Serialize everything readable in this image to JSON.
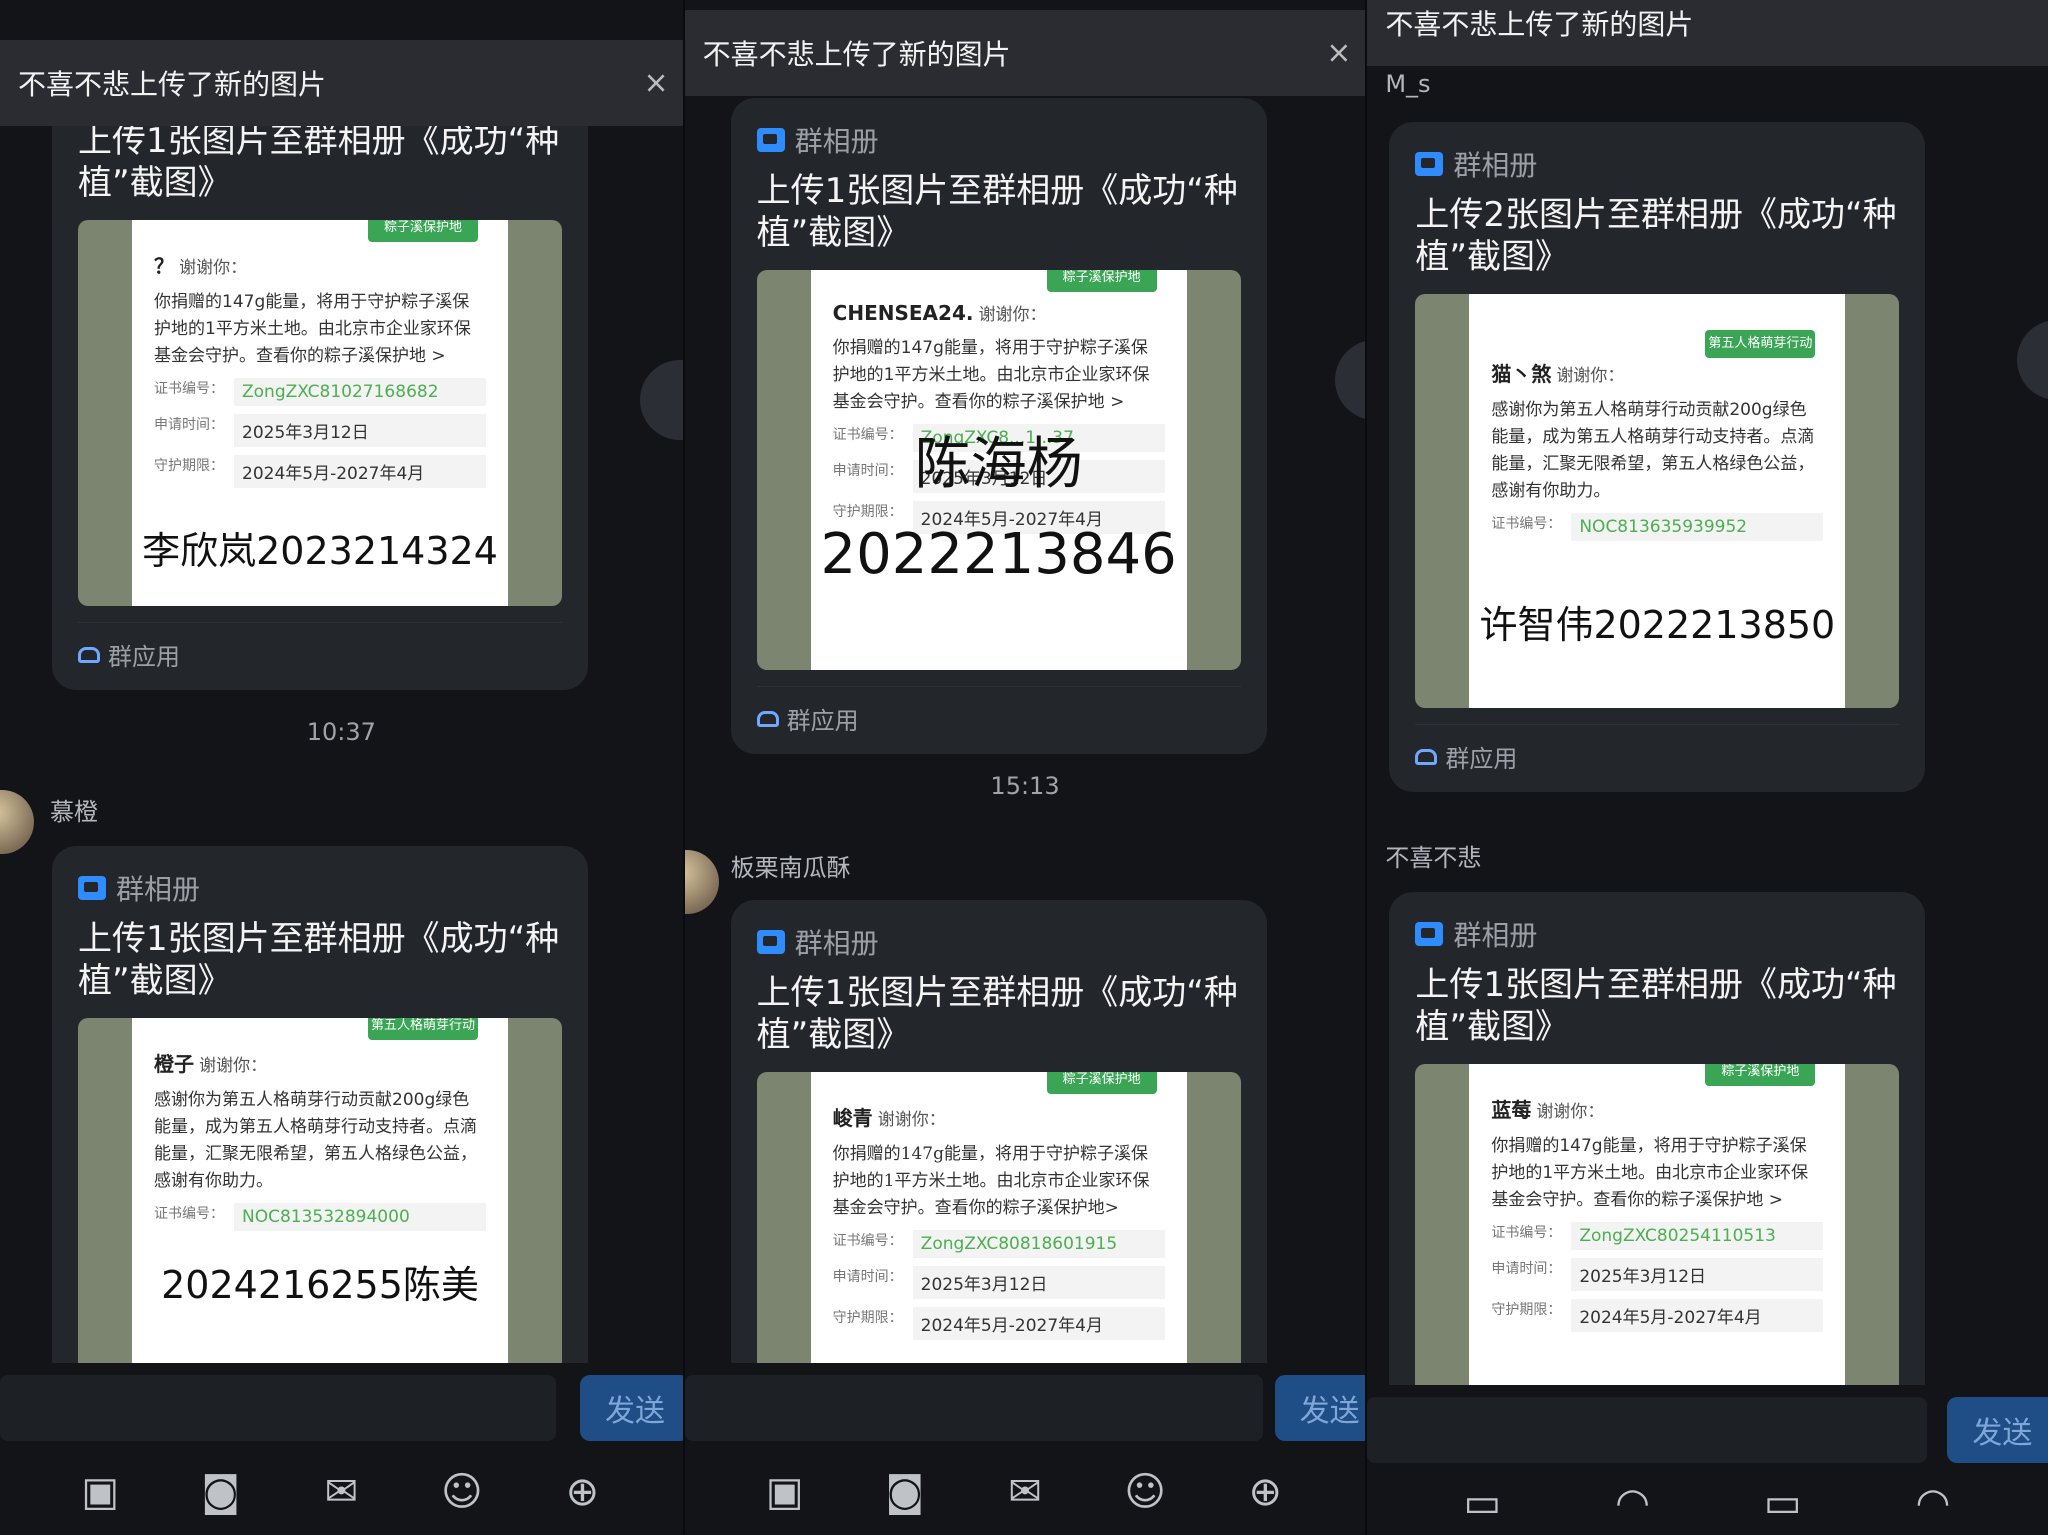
{
  "panels": [
    {
      "notification": {
        "text": "不喜不悲上传了新的图片",
        "close": "×"
      },
      "cards": [
        {
          "head": "群相册",
          "title": "上传1张图片至群相册《成功“种植”截图》",
          "cert": {
            "ribbon": "粽子溪保护地",
            "name": "？",
            "thanks": "谢谢你：",
            "body": "你捐赠的147g能量，将用于守护粽子溪保护地的1平方米土地。由北京市企业家环保基金会守护。查看你的粽子溪保护地 >",
            "rows": [
              {
                "k": "证书编号：",
                "v": "ZongZXC81027168682"
              },
              {
                "k": "申请时间：",
                "v": "2025年3月12日"
              },
              {
                "k": "守护期限：",
                "v": "2024年5月-2027年4月"
              }
            ],
            "overlay": "李欣岚2023214324"
          },
          "foot": "群应用"
        },
        {
          "head": "群相册",
          "title": "上传1张图片至群相册《成功“种植”截图》",
          "cert": {
            "ribbon": "第五人格萌芽行动",
            "name": "橙子",
            "thanks": "谢谢你：",
            "body": "感谢你为第五人格萌芽行动贡献200g绿色能量，成为第五人格萌芽行动支持者。点滴能量，汇聚无限希望，第五人格绿色公益，感谢有你助力。",
            "rows": [
              {
                "k": "证书编号：",
                "v": "NOC813532894000"
              }
            ],
            "overlay": "2024216255陈美"
          },
          "foot": ""
        }
      ],
      "timestamp": "10:37",
      "sender": "慕橙",
      "send": "发送"
    },
    {
      "notification": {
        "text": "不喜不悲上传了新的图片",
        "close": "×"
      },
      "cards": [
        {
          "head": "群相册",
          "title": "上传1张图片至群相册《成功“种植”截图》",
          "cert": {
            "ribbon": "粽子溪保护地",
            "name": "CHENSEA24.",
            "thanks": "谢谢你：",
            "body": "你捐赠的147g能量，将用于守护粽子溪保护地的1平方米土地。由北京市企业家环保基金会守护。查看你的粽子溪保护地 >",
            "rows": [
              {
                "k": "证书编号：",
                "v": "ZongZXC8...1...37"
              },
              {
                "k": "申请时间：",
                "v": "2025年3月12日"
              },
              {
                "k": "守护期限：",
                "v": "2024年5月-2027年4月"
              }
            ],
            "overlay": "陈海杨\n2022213846"
          },
          "foot": "群应用"
        },
        {
          "head": "群相册",
          "title": "上传1张图片至群相册《成功“种植”截图》",
          "cert": {
            "ribbon": "粽子溪保护地",
            "name": "峻青",
            "thanks": "谢谢你：",
            "body": "你捐赠的147g能量，将用于守护粽子溪保护地的1平方米土地。由北京市企业家环保基金会守护。查看你的粽子溪保护地>",
            "rows": [
              {
                "k": "证书编号：",
                "v": "ZongZXC80818601915"
              },
              {
                "k": "申请时间：",
                "v": "2025年3月12日"
              },
              {
                "k": "守护期限：",
                "v": "2024年5月-2027年4月"
              }
            ],
            "overlay": ""
          },
          "foot": ""
        }
      ],
      "timestamp": "15:13",
      "sender": "板栗南瓜酥",
      "send": "发送"
    },
    {
      "notification": {
        "text": "不喜不悲上传了新的图片",
        "close": ""
      },
      "sender_top": "M_s",
      "cards": [
        {
          "head": "群相册",
          "title": "上传2张图片至群相册《成功“种植”截图》",
          "cert": {
            "ribbon": "第五人格萌芽行动",
            "name": "猫丶煞",
            "thanks": "谢谢你：",
            "body": "感谢你为第五人格萌芽行动贡献200g绿色能量，成为第五人格萌芽行动支持者。点滴能量，汇聚无限希望，第五人格绿色公益，感谢有你助力。",
            "rows": [
              {
                "k": "证书编号：",
                "v": "NOC813635939952"
              }
            ],
            "overlay": "许智伟2022213850"
          },
          "foot": "群应用"
        },
        {
          "head": "群相册",
          "title": "上传1张图片至群相册《成功“种植”截图》",
          "cert": {
            "ribbon": "粽子溪保护地",
            "name": "蓝莓",
            "thanks": "谢谢你：",
            "body": "你捐赠的147g能量，将用于守护粽子溪保护地的1平方米土地。由北京市企业家环保基金会守护。查看你的粽子溪保护地 >",
            "rows": [
              {
                "k": "证书编号：",
                "v": "ZongZXC80254110513"
              },
              {
                "k": "申请时间：",
                "v": "2025年3月12日"
              },
              {
                "k": "守护期限：",
                "v": "2024年5月-2027年4月"
              }
            ],
            "overlay": ""
          },
          "foot": ""
        }
      ],
      "sender": "不喜不悲",
      "send": "发送"
    }
  ],
  "toolbar_icons": [
    "image-icon",
    "camera-icon",
    "red-packet-icon",
    "emoji-icon",
    "plus-icon"
  ]
}
